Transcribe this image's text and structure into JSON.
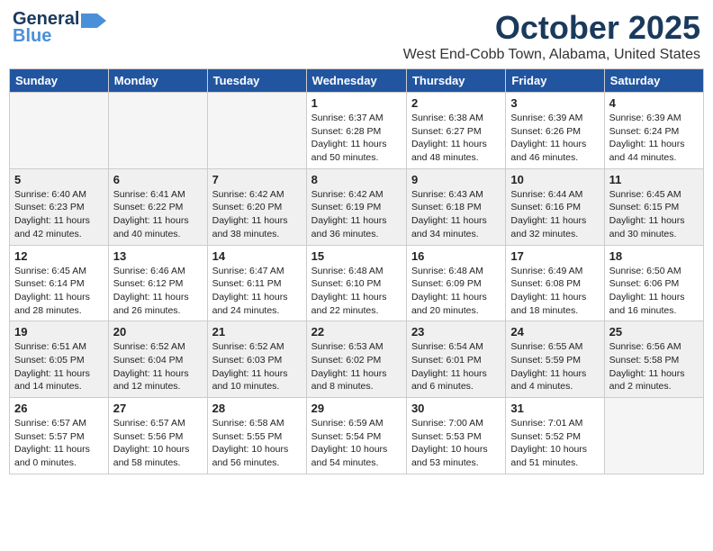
{
  "header": {
    "logo_line1": "General",
    "logo_line2": "Blue",
    "month": "October 2025",
    "location": "West End-Cobb Town, Alabama, United States"
  },
  "days_of_week": [
    "Sunday",
    "Monday",
    "Tuesday",
    "Wednesday",
    "Thursday",
    "Friday",
    "Saturday"
  ],
  "weeks": [
    [
      {
        "day": "",
        "info": ""
      },
      {
        "day": "",
        "info": ""
      },
      {
        "day": "",
        "info": ""
      },
      {
        "day": "1",
        "info": "Sunrise: 6:37 AM\nSunset: 6:28 PM\nDaylight: 11 hours\nand 50 minutes."
      },
      {
        "day": "2",
        "info": "Sunrise: 6:38 AM\nSunset: 6:27 PM\nDaylight: 11 hours\nand 48 minutes."
      },
      {
        "day": "3",
        "info": "Sunrise: 6:39 AM\nSunset: 6:26 PM\nDaylight: 11 hours\nand 46 minutes."
      },
      {
        "day": "4",
        "info": "Sunrise: 6:39 AM\nSunset: 6:24 PM\nDaylight: 11 hours\nand 44 minutes."
      }
    ],
    [
      {
        "day": "5",
        "info": "Sunrise: 6:40 AM\nSunset: 6:23 PM\nDaylight: 11 hours\nand 42 minutes."
      },
      {
        "day": "6",
        "info": "Sunrise: 6:41 AM\nSunset: 6:22 PM\nDaylight: 11 hours\nand 40 minutes."
      },
      {
        "day": "7",
        "info": "Sunrise: 6:42 AM\nSunset: 6:20 PM\nDaylight: 11 hours\nand 38 minutes."
      },
      {
        "day": "8",
        "info": "Sunrise: 6:42 AM\nSunset: 6:19 PM\nDaylight: 11 hours\nand 36 minutes."
      },
      {
        "day": "9",
        "info": "Sunrise: 6:43 AM\nSunset: 6:18 PM\nDaylight: 11 hours\nand 34 minutes."
      },
      {
        "day": "10",
        "info": "Sunrise: 6:44 AM\nSunset: 6:16 PM\nDaylight: 11 hours\nand 32 minutes."
      },
      {
        "day": "11",
        "info": "Sunrise: 6:45 AM\nSunset: 6:15 PM\nDaylight: 11 hours\nand 30 minutes."
      }
    ],
    [
      {
        "day": "12",
        "info": "Sunrise: 6:45 AM\nSunset: 6:14 PM\nDaylight: 11 hours\nand 28 minutes."
      },
      {
        "day": "13",
        "info": "Sunrise: 6:46 AM\nSunset: 6:12 PM\nDaylight: 11 hours\nand 26 minutes."
      },
      {
        "day": "14",
        "info": "Sunrise: 6:47 AM\nSunset: 6:11 PM\nDaylight: 11 hours\nand 24 minutes."
      },
      {
        "day": "15",
        "info": "Sunrise: 6:48 AM\nSunset: 6:10 PM\nDaylight: 11 hours\nand 22 minutes."
      },
      {
        "day": "16",
        "info": "Sunrise: 6:48 AM\nSunset: 6:09 PM\nDaylight: 11 hours\nand 20 minutes."
      },
      {
        "day": "17",
        "info": "Sunrise: 6:49 AM\nSunset: 6:08 PM\nDaylight: 11 hours\nand 18 minutes."
      },
      {
        "day": "18",
        "info": "Sunrise: 6:50 AM\nSunset: 6:06 PM\nDaylight: 11 hours\nand 16 minutes."
      }
    ],
    [
      {
        "day": "19",
        "info": "Sunrise: 6:51 AM\nSunset: 6:05 PM\nDaylight: 11 hours\nand 14 minutes."
      },
      {
        "day": "20",
        "info": "Sunrise: 6:52 AM\nSunset: 6:04 PM\nDaylight: 11 hours\nand 12 minutes."
      },
      {
        "day": "21",
        "info": "Sunrise: 6:52 AM\nSunset: 6:03 PM\nDaylight: 11 hours\nand 10 minutes."
      },
      {
        "day": "22",
        "info": "Sunrise: 6:53 AM\nSunset: 6:02 PM\nDaylight: 11 hours\nand 8 minutes."
      },
      {
        "day": "23",
        "info": "Sunrise: 6:54 AM\nSunset: 6:01 PM\nDaylight: 11 hours\nand 6 minutes."
      },
      {
        "day": "24",
        "info": "Sunrise: 6:55 AM\nSunset: 5:59 PM\nDaylight: 11 hours\nand 4 minutes."
      },
      {
        "day": "25",
        "info": "Sunrise: 6:56 AM\nSunset: 5:58 PM\nDaylight: 11 hours\nand 2 minutes."
      }
    ],
    [
      {
        "day": "26",
        "info": "Sunrise: 6:57 AM\nSunset: 5:57 PM\nDaylight: 11 hours\nand 0 minutes."
      },
      {
        "day": "27",
        "info": "Sunrise: 6:57 AM\nSunset: 5:56 PM\nDaylight: 10 hours\nand 58 minutes."
      },
      {
        "day": "28",
        "info": "Sunrise: 6:58 AM\nSunset: 5:55 PM\nDaylight: 10 hours\nand 56 minutes."
      },
      {
        "day": "29",
        "info": "Sunrise: 6:59 AM\nSunset: 5:54 PM\nDaylight: 10 hours\nand 54 minutes."
      },
      {
        "day": "30",
        "info": "Sunrise: 7:00 AM\nSunset: 5:53 PM\nDaylight: 10 hours\nand 53 minutes."
      },
      {
        "day": "31",
        "info": "Sunrise: 7:01 AM\nSunset: 5:52 PM\nDaylight: 10 hours\nand 51 minutes."
      },
      {
        "day": "",
        "info": ""
      }
    ]
  ]
}
